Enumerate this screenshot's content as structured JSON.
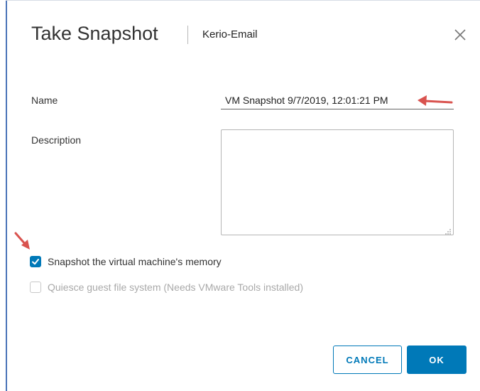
{
  "dialog": {
    "title": "Take Snapshot",
    "subtitle": "Kerio-Email",
    "close_icon": "close-icon"
  },
  "form": {
    "name_label": "Name",
    "name_value": "VM Snapshot 9/7/2019, 12:01:21 PM",
    "description_label": "Description",
    "description_value": ""
  },
  "options": {
    "memory": {
      "label": "Snapshot the virtual machine's memory",
      "checked": true,
      "enabled": true
    },
    "quiesce": {
      "label": "Quiesce guest file system (Needs VMware Tools installed)",
      "checked": false,
      "enabled": false
    }
  },
  "annotations": {
    "arrow_color": "#d9534f"
  },
  "buttons": {
    "cancel_label": "CANCEL",
    "ok_label": "OK"
  },
  "colors": {
    "accent": "#0079b8",
    "window_edge": "#4a73b8"
  }
}
